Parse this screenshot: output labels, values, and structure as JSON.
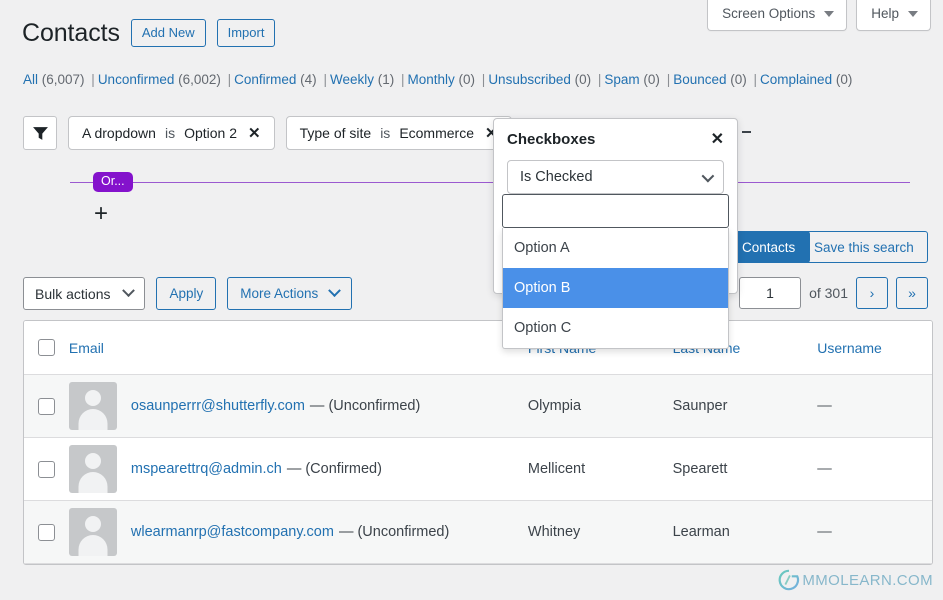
{
  "meta": {
    "screen_options_label": "Screen Options",
    "help_label": "Help"
  },
  "header": {
    "title": "Contacts",
    "add_new_label": "Add New",
    "import_label": "Import"
  },
  "status_links": [
    {
      "label": "All",
      "count": "(6,007)"
    },
    {
      "label": "Unconfirmed",
      "count": "(6,002)"
    },
    {
      "label": "Confirmed",
      "count": "(4)"
    },
    {
      "label": "Weekly",
      "count": "(1)"
    },
    {
      "label": "Monthly",
      "count": "(0)"
    },
    {
      "label": "Unsubscribed",
      "count": "(0)"
    },
    {
      "label": "Spam",
      "count": "(0)"
    },
    {
      "label": "Bounced",
      "count": "(0)"
    },
    {
      "label": "Complained",
      "count": "(0)"
    }
  ],
  "filters": {
    "chips": [
      {
        "field": "A dropdown",
        "operator": "is",
        "value": "Option 2",
        "remove": "✕"
      },
      {
        "field": "Type of site",
        "operator": "is",
        "value": "Ecommerce",
        "remove": "✕"
      }
    ],
    "or_label": "Or...",
    "add_label": "+",
    "or_color": "#8412cc"
  },
  "actions": {
    "find_contacts_label": "Find Contacts",
    "save_search_label": "Save this search",
    "primary_color": "#2271b1"
  },
  "bulk": {
    "bulk_actions_label": "Bulk actions",
    "apply_label": "Apply",
    "more_actions_label": "More Actions"
  },
  "pagination": {
    "current_page": "1",
    "of_label": "of 301",
    "next_label": "›",
    "last_label": "»"
  },
  "table": {
    "columns": [
      "Email",
      "First Name",
      "Last Name",
      "Username"
    ],
    "rows": [
      {
        "email": "osaunperrr@shutterfly.com",
        "status": "— (Unconfirmed)",
        "first_name": "Olympia",
        "last_name": "Saunper",
        "username": "—"
      },
      {
        "email": "mspearettrq@admin.ch",
        "status": "— (Confirmed)",
        "first_name": "Mellicent",
        "last_name": "Spearett",
        "username": "—"
      },
      {
        "email": "wlearmanrp@fastcompany.com",
        "status": "— (Unconfirmed)",
        "first_name": "Whitney",
        "last_name": "Learman",
        "username": "—"
      }
    ]
  },
  "dropdown": {
    "title": "Checkboxes",
    "close_label": "✕",
    "condition_value": "Is Checked",
    "search_value": "",
    "search_placeholder": "",
    "options": [
      {
        "label": "Option A",
        "selected": false
      },
      {
        "label": "Option B",
        "selected": true
      },
      {
        "label": "Option C",
        "selected": false
      }
    ],
    "highlight_color": "#4a90e8"
  },
  "watermark": {
    "text": "MMOLEARN.COM"
  }
}
